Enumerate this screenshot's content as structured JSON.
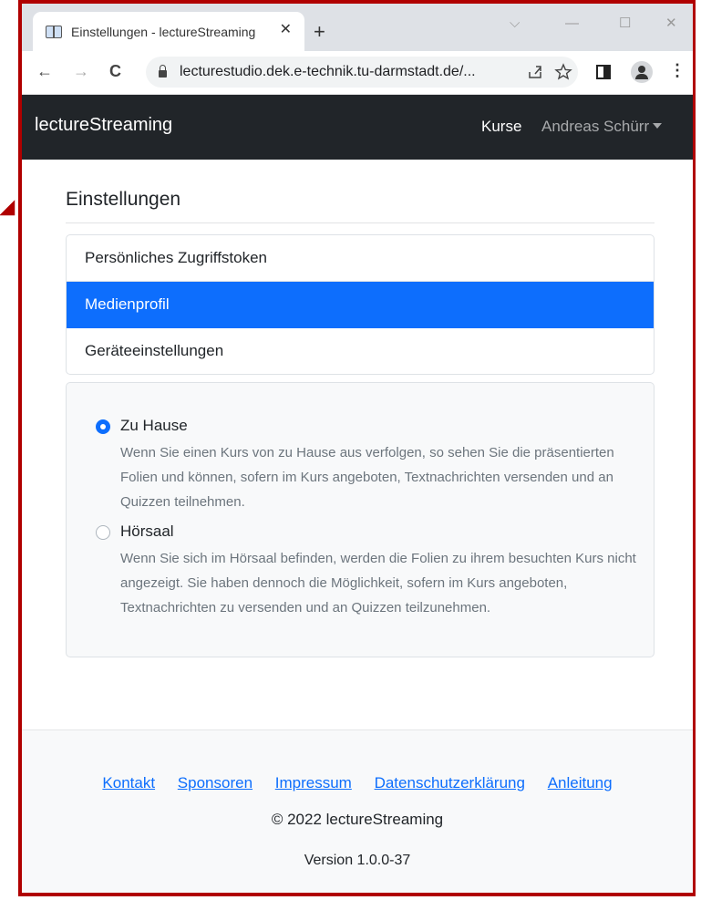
{
  "browser": {
    "tab_title": "Einstellungen - lectureStreaming",
    "tab_close": "✕",
    "new_tab": "+",
    "url": "lecturestudio.dek.e-technik.tu-darmstadt.de/...",
    "window_controls": {
      "dropdown": "⌵",
      "minimize": "—",
      "maximize": "☐",
      "close": "✕"
    },
    "nav": {
      "back": "←",
      "forward": "→",
      "reload": "C"
    },
    "icons": {
      "share": "share-icon",
      "star": "star-icon",
      "side_panel": "side-panel-icon",
      "profile": "profile-icon",
      "menu": "⋮"
    }
  },
  "navbar": {
    "brand": "lectureStreaming",
    "links": {
      "courses": "Kurse",
      "user": "Andreas Schürr"
    }
  },
  "settings": {
    "heading": "Einstellungen",
    "menu": [
      {
        "label": "Persönliches Zugriffstoken",
        "active": false
      },
      {
        "label": "Medienprofil",
        "active": true
      },
      {
        "label": "Geräteeinstellungen",
        "active": false
      }
    ],
    "media_profile": {
      "options": [
        {
          "label": "Zu Hause",
          "checked": true,
          "description": "Wenn Sie einen Kurs von zu Hause aus verfolgen, so sehen Sie die präsentierten Folien und können, sofern im Kurs angeboten, Textnachrichten versenden und an Quizzen teilnehmen."
        },
        {
          "label": "Hörsaal",
          "checked": false,
          "description": "Wenn Sie sich im Hörsaal befinden, werden die Folien zu ihrem besuchten Kurs nicht angezeigt. Sie haben dennoch die Möglichkeit, sofern im Kurs angeboten, Textnachrichten zu versenden und an Quizzen teilzunehmen."
        }
      ]
    }
  },
  "footer": {
    "links": [
      "Kontakt",
      "Sponsoren",
      "Impressum",
      "Datenschutzerklärung",
      "Anleitung"
    ],
    "copyright": "© 2022 lectureStreaming",
    "version": "Version 1.0.0-37"
  },
  "colors": {
    "accent": "#0d6efd",
    "navbar": "#212529",
    "frame": "#b00000"
  }
}
